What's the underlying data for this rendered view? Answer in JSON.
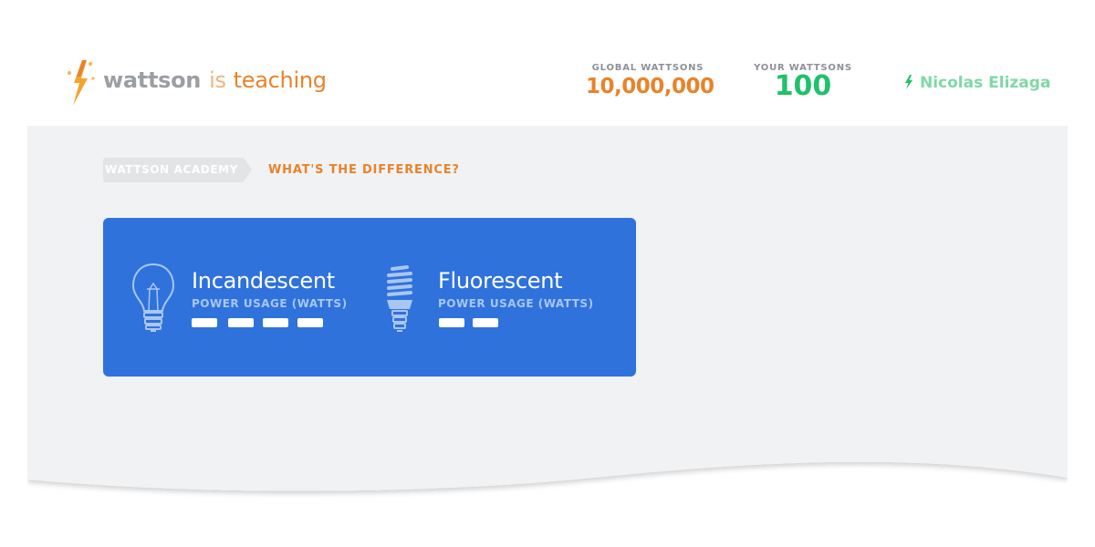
{
  "header": {
    "brand": {
      "name": "wattson",
      "connector": "is",
      "status": "teaching"
    },
    "stats": [
      {
        "label": "GLOBAL WATTSONS",
        "value": "10,000,000"
      },
      {
        "label": "YOUR WATTSONS",
        "value": "100"
      }
    ],
    "user": {
      "name": "Nicolas Elizaga",
      "icon": "lightning-bolt-icon"
    }
  },
  "breadcrumb": {
    "parent": "WATTSON ACADEMY",
    "current": "WHAT'S THE DIFFERENCE?"
  },
  "comparison": [
    {
      "title": "Incandescent",
      "subtitle": "POWER USAGE (WATTS)",
      "icon": "incandescent-bulb-icon",
      "usage_units": 4
    },
    {
      "title": "Fluorescent",
      "subtitle": "POWER USAGE (WATTS)",
      "icon": "fluorescent-bulb-icon",
      "usage_units": 2
    }
  ],
  "colors": {
    "accent_orange": "#e8832a",
    "accent_green": "#21c06b",
    "card_blue": "#2f72dc",
    "background": "#f1f2f4"
  }
}
